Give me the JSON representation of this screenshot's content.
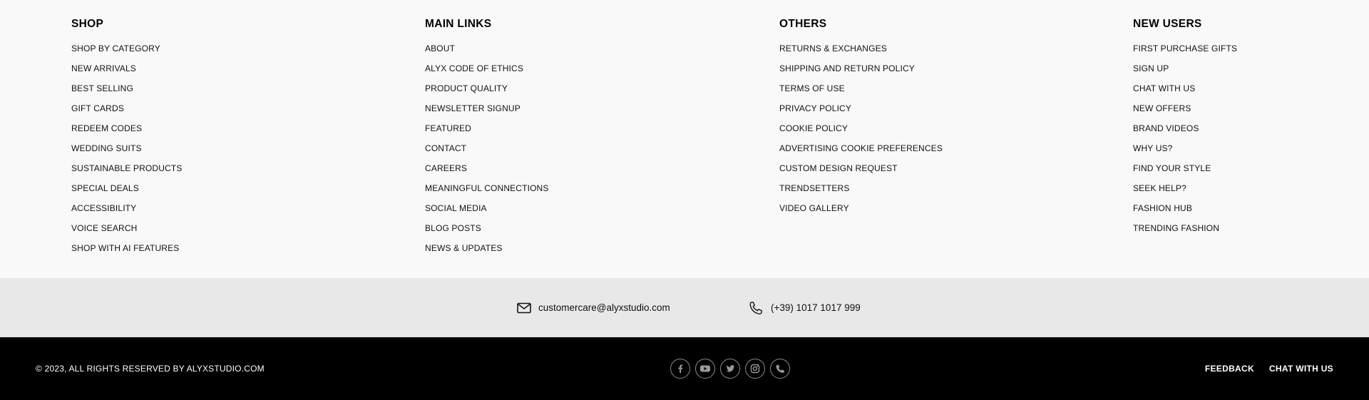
{
  "columns": {
    "shop": {
      "heading": "SHOP",
      "items": [
        "SHOP BY CATEGORY",
        "NEW ARRIVALS",
        "BEST SELLING",
        "GIFT CARDS",
        "REDEEM CODES",
        "WEDDING SUITS",
        "SUSTAINABLE PRODUCTS",
        "SPECIAL DEALS",
        "ACCESSIBILITY",
        "VOICE SEARCH",
        "SHOP WITH AI FEATURES"
      ]
    },
    "main_links": {
      "heading": "MAIN LINKS",
      "items": [
        "ABOUT",
        "ALYX CODE OF ETHICS",
        "PRODUCT QUALITY",
        "NEWSLETTER SIGNUP",
        "FEATURED",
        "CONTACT",
        "CAREERS",
        "MEANINGFUL CONNECTIONS",
        "SOCIAL MEDIA",
        "BLOG POSTS",
        "NEWS & UPDATES"
      ]
    },
    "others": {
      "heading": "OTHERS",
      "items": [
        "RETURNS & EXCHANGES",
        "SHIPPING AND RETURN POLICY",
        "TERMS OF USE",
        "PRIVACY POLICY",
        "COOKIE POLICY",
        "ADVERTISING COOKIE PREFERENCES",
        "CUSTOM DESIGN REQUEST",
        "TRENDSETTERS",
        "VIDEO GALLERY"
      ]
    },
    "new_users": {
      "heading": "NEW USERS",
      "items": [
        "FIRST PURCHASE GIFTS",
        "SIGN UP",
        "CHAT WITH US",
        "NEW OFFERS",
        "BRAND VIDEOS",
        "WHY US?",
        "FIND YOUR STYLE",
        "SEEK HELP?",
        "FASHION HUB",
        "TRENDING FASHION"
      ]
    }
  },
  "contact": {
    "email": "customercare@alyxstudio.com",
    "phone": "(+39) 1017 1017 999",
    "email_icon": "mail-icon",
    "phone_icon": "phone-icon"
  },
  "footer": {
    "copyright": "© 2023, ALL RIGHTS RESERVED BY ALYXSTUDIO.COM",
    "social_icons": [
      "facebook-icon",
      "youtube-icon",
      "twitter-icon",
      "instagram-icon",
      "whatsapp-icon"
    ],
    "links": {
      "feedback": "FEEDBACK",
      "chat": "CHAT WITH US"
    }
  },
  "colors": {
    "links_background": "#f9f9f9",
    "contact_background": "#e8e8e8",
    "footer_background": "#000000",
    "footer_text": "#ffffff",
    "social_icon_stroke": "#8a8a8a"
  }
}
